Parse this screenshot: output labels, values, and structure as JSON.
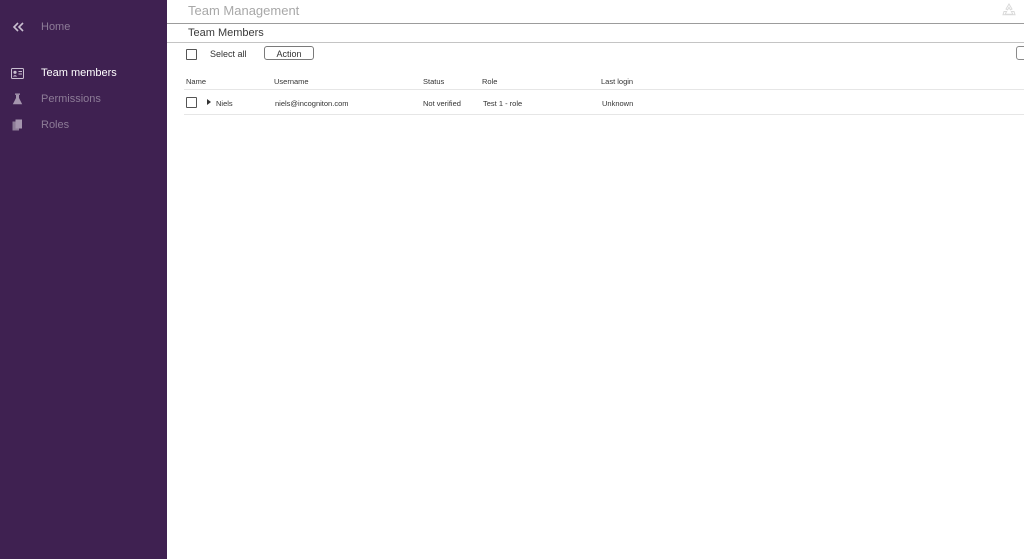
{
  "sidebar": {
    "home": {
      "label": "Home",
      "icon": "double-chevron-left-icon"
    },
    "items": [
      {
        "label": "Team members",
        "icon": "id-card-icon",
        "active": true
      },
      {
        "label": "Permissions",
        "icon": "flask-icon",
        "active": false
      },
      {
        "label": "Roles",
        "icon": "documents-icon",
        "active": false
      }
    ]
  },
  "header": {
    "title": "Team Management",
    "corner_icon": "recycle-icon"
  },
  "section": {
    "title": "Team Members"
  },
  "toolbar": {
    "select_all_label": "Select all",
    "action_label": "Action"
  },
  "table": {
    "columns": [
      "Name",
      "Username",
      "Status",
      "Role",
      "Last login"
    ],
    "rows": [
      {
        "name": "Niels",
        "username": "niels@incogniton.com",
        "status": "Not verified",
        "role": "Test 1  - role",
        "last_login": "Unknown"
      }
    ]
  },
  "colors": {
    "sidebar_bg": "#3f2151",
    "sidebar_active_text": "#ffffff",
    "sidebar_dim_text": "#8d7c97"
  }
}
